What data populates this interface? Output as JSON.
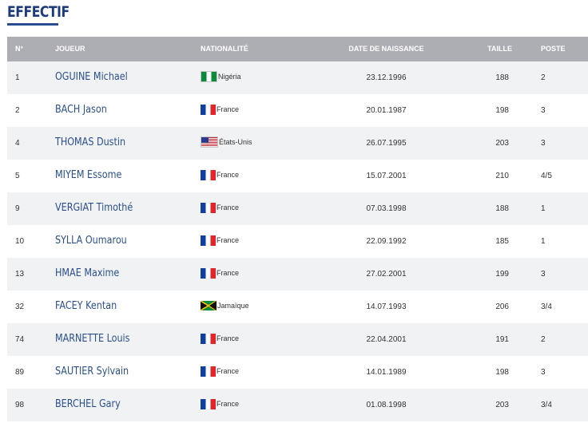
{
  "section": {
    "title": "EFFECTIF"
  },
  "table": {
    "headers": {
      "number": "N°",
      "player": "JOUEUR",
      "nationality": "NATIONALITÉ",
      "birthdate": "DATE DE NAISSANCE",
      "height": "TAILLE",
      "position": "POSTE"
    },
    "rows": [
      {
        "number": "1",
        "player": "OGUINE Michael",
        "flag": "nigeria-flag-icon",
        "nationality": "Nigéria",
        "birthdate": "23.12.1996",
        "height": "188",
        "position": "2"
      },
      {
        "number": "2",
        "player": "BACH Jason",
        "flag": "france-flag-icon",
        "nationality": "France",
        "birthdate": "20.01.1987",
        "height": "198",
        "position": "3"
      },
      {
        "number": "4",
        "player": "THOMAS Dustin",
        "flag": "usa-flag-icon",
        "nationality": "États-Unis",
        "birthdate": "26.07.1995",
        "height": "203",
        "position": "3"
      },
      {
        "number": "5",
        "player": "MIYEM Essome",
        "flag": "france-flag-icon",
        "nationality": "France",
        "birthdate": "15.07.2001",
        "height": "210",
        "position": "4/5"
      },
      {
        "number": "9",
        "player": "VERGIAT Timothé",
        "flag": "france-flag-icon",
        "nationality": "France",
        "birthdate": "07.03.1998",
        "height": "188",
        "position": "1"
      },
      {
        "number": "10",
        "player": "SYLLA Oumarou",
        "flag": "france-flag-icon",
        "nationality": "France",
        "birthdate": "22.09.1992",
        "height": "185",
        "position": "1"
      },
      {
        "number": "13",
        "player": "HMAE Maxime",
        "flag": "france-flag-icon",
        "nationality": "France",
        "birthdate": "27.02.2001",
        "height": "199",
        "position": "3"
      },
      {
        "number": "32",
        "player": "FACEY Kentan",
        "flag": "jamaica-flag-icon",
        "nationality": "Jamaïque",
        "birthdate": "14.07.1993",
        "height": "206",
        "position": "3/4"
      },
      {
        "number": "74",
        "player": "MARNETTE Louis",
        "flag": "france-flag-icon",
        "nationality": "France",
        "birthdate": "22.04.2001",
        "height": "191",
        "position": "2"
      },
      {
        "number": "89",
        "player": "SAUTIER Sylvain",
        "flag": "france-flag-icon",
        "nationality": "France",
        "birthdate": "14.01.1989",
        "height": "198",
        "position": "3"
      },
      {
        "number": "98",
        "player": "BERCHEL Gary",
        "flag": "france-flag-icon",
        "nationality": "France",
        "birthdate": "01.08.1998",
        "height": "203",
        "position": "3/4"
      }
    ]
  },
  "colors": {
    "title": "#1d3a7a",
    "header_bg": "#adaeb3",
    "row_alt_bg": "#f1f2f4",
    "player_link": "#2a4f8c"
  }
}
